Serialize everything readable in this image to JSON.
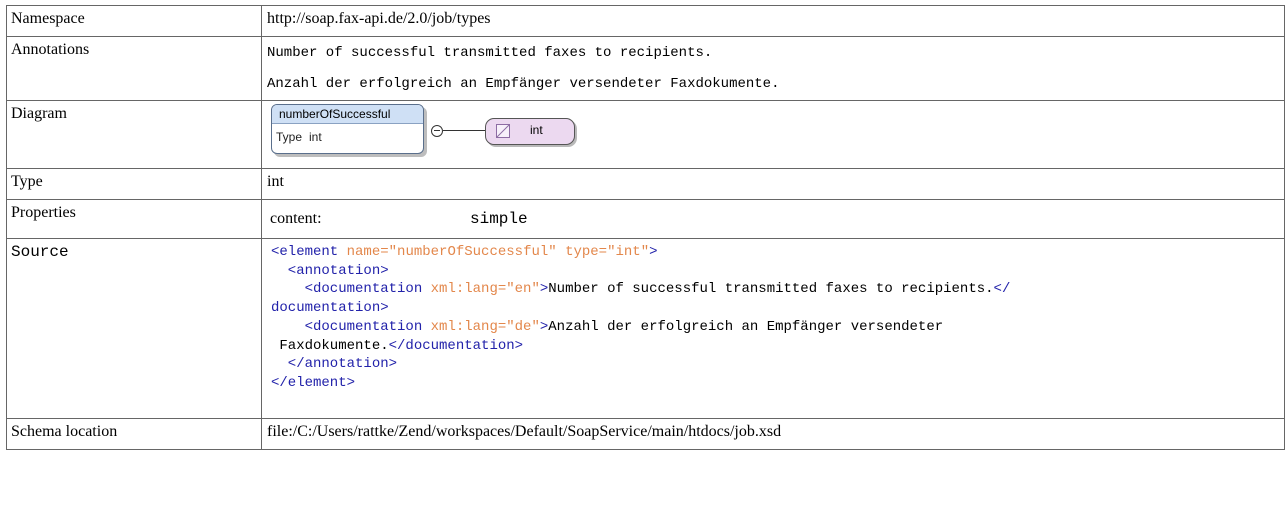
{
  "rows": {
    "namespace": {
      "label": "Namespace",
      "value": "http://soap.fax-api.de/2.0/job/types"
    },
    "annotations": {
      "label": "Annotations",
      "lines": [
        "Number of successful transmitted faxes to recipients.",
        "Anzahl der erfolgreich an Empfänger versendeter Faxdokumente."
      ]
    },
    "diagram": {
      "label": "Diagram",
      "element_name": "numberOfSuccessful",
      "type_key": "Type",
      "type_value": "int",
      "type_ref": "int",
      "colors": {
        "element_header": "#cfe0f5",
        "type_box": "#ecd9f0"
      },
      "icons": [
        "sequence-compositor-icon",
        "simple-type-icon"
      ]
    },
    "type": {
      "label": "Type",
      "value": "int"
    },
    "properties": {
      "label": "Properties",
      "key": "content:",
      "value": "simple"
    },
    "source": {
      "label": "Source",
      "l1_tag": "<element",
      "l1_a1": " name=",
      "l1_v1": "\"numberOfSuccessful\"",
      "l1_a2": " type=",
      "l1_v2": "\"int\"",
      "l1_end": ">",
      "l2_tag": "  <annotation>",
      "l3_tag": "    <documentation",
      "l3_a": " xml:lang=",
      "l3_v": "\"en\"",
      "l3_gt": ">",
      "l3_txt": "Number of successful transmitted faxes to recipients.",
      "l3_close": "</",
      "l4_close": "documentation>",
      "l5_tag": "    <documentation",
      "l5_a": " xml:lang=",
      "l5_v": "\"de\"",
      "l5_gt": ">",
      "l5_txt": "Anzahl der erfolgreich an Empfänger versendeter",
      "l6_txt": " Faxdokumente.",
      "l6_close": "</documentation>",
      "l7_tag": "  </annotation>",
      "l8_tag": "</element>",
      "colors": {
        "tag": "#2222aa",
        "attribute": "#e3874b"
      }
    },
    "schema_location": {
      "label": "Schema location",
      "value": "file:/C:/Users/rattke/Zend/workspaces/Default/SoapService/main/htdocs/job.xsd"
    }
  }
}
